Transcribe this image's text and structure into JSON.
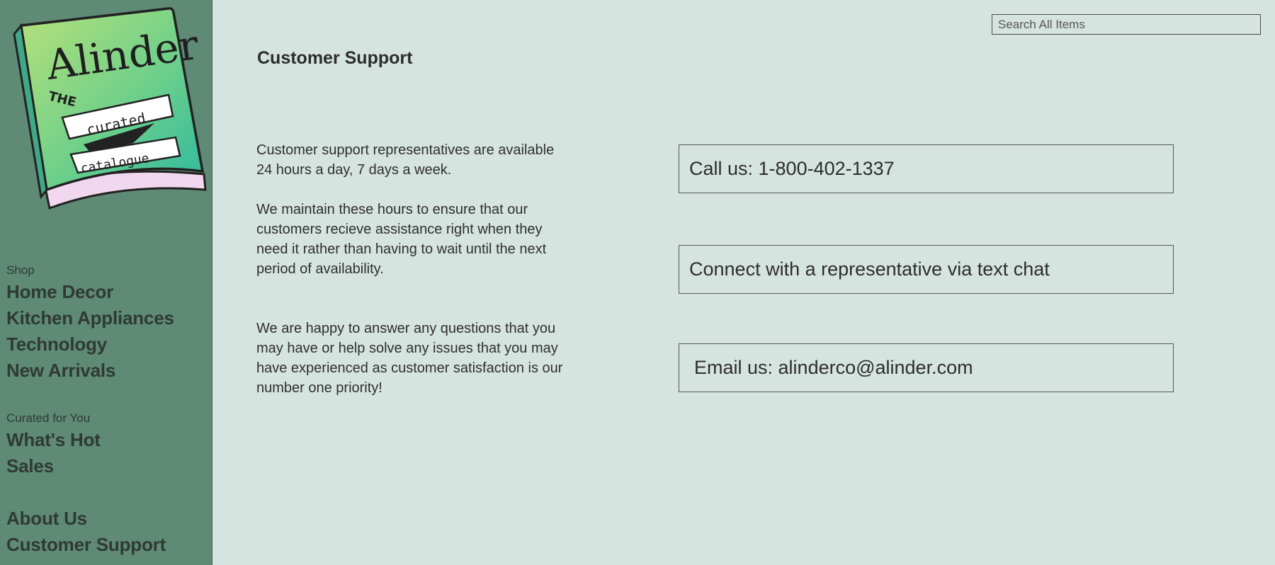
{
  "logo": {
    "brand": "Alinder",
    "line1": "THE",
    "line2": "curated",
    "line3": "catalogue"
  },
  "sidebar": {
    "shop_label": "Shop",
    "shop_items": [
      {
        "label": "Home Decor"
      },
      {
        "label": "Kitchen Appliances"
      },
      {
        "label": "Technology"
      },
      {
        "label": "New Arrivals"
      }
    ],
    "curated_label": "Curated for You",
    "curated_items": [
      {
        "label": "What's Hot"
      },
      {
        "label": "Sales"
      }
    ],
    "info_items": [
      {
        "label": "About Us"
      },
      {
        "label": "Customer Support"
      }
    ]
  },
  "search": {
    "placeholder": "Search All Items"
  },
  "main": {
    "title": "Customer Support",
    "paragraphs": [
      "Customer support representatives are available 24 hours a day, 7 days a week.",
      "We maintain these hours to ensure that our customers recieve assistance right when they need it rather than having to wait until the next period of availability.",
      "We are happy to answer any questions that you may have or help solve any issues that you may have experienced as customer satisfaction is our number one priority!"
    ],
    "contacts": [
      {
        "label": "Call us: 1-800-402-1337"
      },
      {
        "label": "Connect with a representative via text chat"
      },
      {
        "label": "Email us: alinderco@alinder.com"
      }
    ]
  },
  "colors": {
    "sidebar_bg": "#5e8a76",
    "page_bg": "#d6e4df",
    "text": "#2d2d2d"
  }
}
